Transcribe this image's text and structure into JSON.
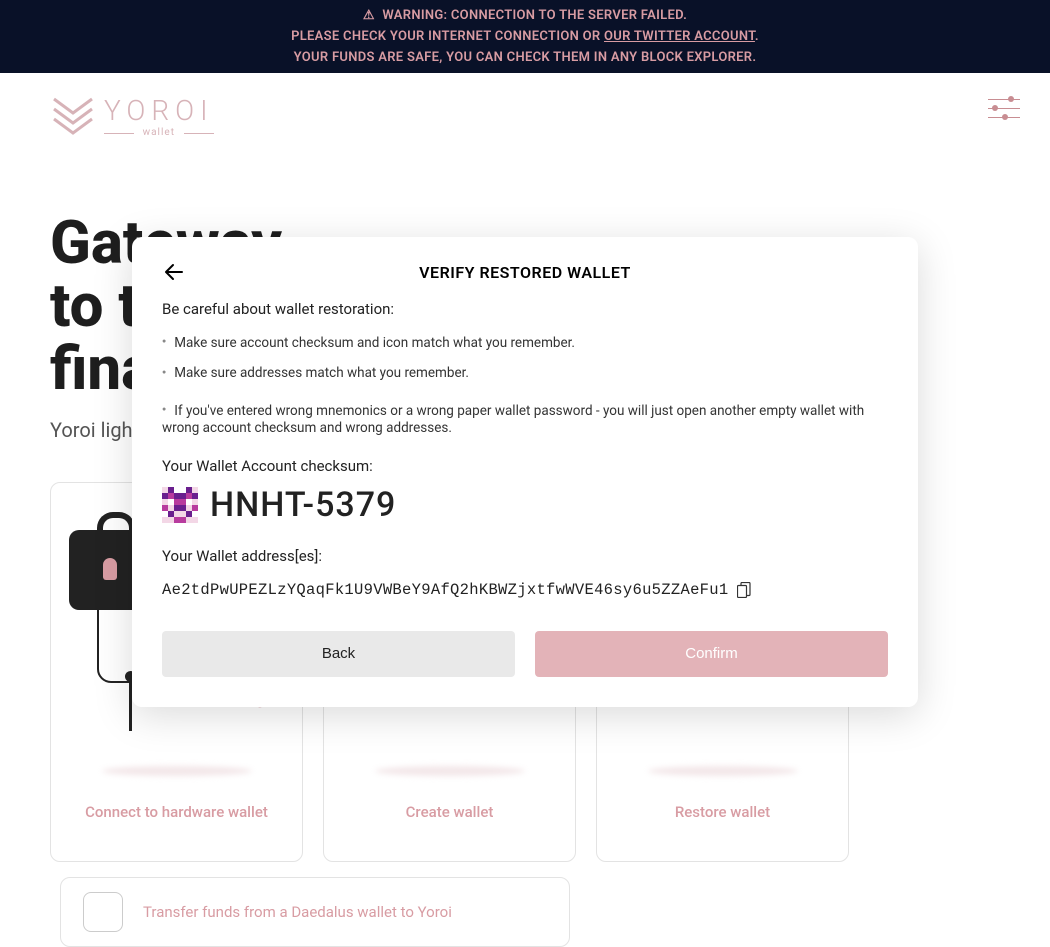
{
  "banner": {
    "line1_prefix": "WARNING: CONNECTION TO THE SERVER FAILED.",
    "line2_prefix": "PLEASE CHECK YOUR INTERNET CONNECTION OR ",
    "line2_link": "OUR TWITTER ACCOUNT",
    "line2_suffix": ".",
    "line3": "YOUR FUNDS ARE SAFE, YOU CAN CHECK THEM IN ANY BLOCK EXPLORER."
  },
  "logo": {
    "name": "YOROI",
    "subtitle": "wallet"
  },
  "hero": {
    "line1": "Gateway",
    "line2": "to the",
    "line3": "financial world",
    "subtitle": "Yoroi light wallet for Cardano assets"
  },
  "cards": {
    "hw": "Connect to hardware wallet",
    "create": "Create wallet",
    "restore": "Restore wallet",
    "transfer": "Transfer funds from a Daedalus wallet to Yoroi"
  },
  "modal": {
    "title": "VERIFY RESTORED WALLET",
    "sub": "Be careful about wallet restoration:",
    "bullet1": "Make sure account checksum and icon match what you remember.",
    "bullet2": "Make sure addresses match what you remember.",
    "bullet3": "If you've entered wrong mnemonics or a wrong paper wallet password - you will just open another empty wallet with wrong account checksum and wrong addresses.",
    "checksum_label": "Your Wallet Account checksum:",
    "checksum": "HNHT-5379",
    "address_label": "Your Wallet address[es]:",
    "address": "Ae2tdPwUPEZLzYQaqFk1U9VWBeY9AfQ2hKBWZjxtfwWVE46sy6u5ZZAeFu1",
    "back": "Back",
    "confirm": "Confirm"
  }
}
